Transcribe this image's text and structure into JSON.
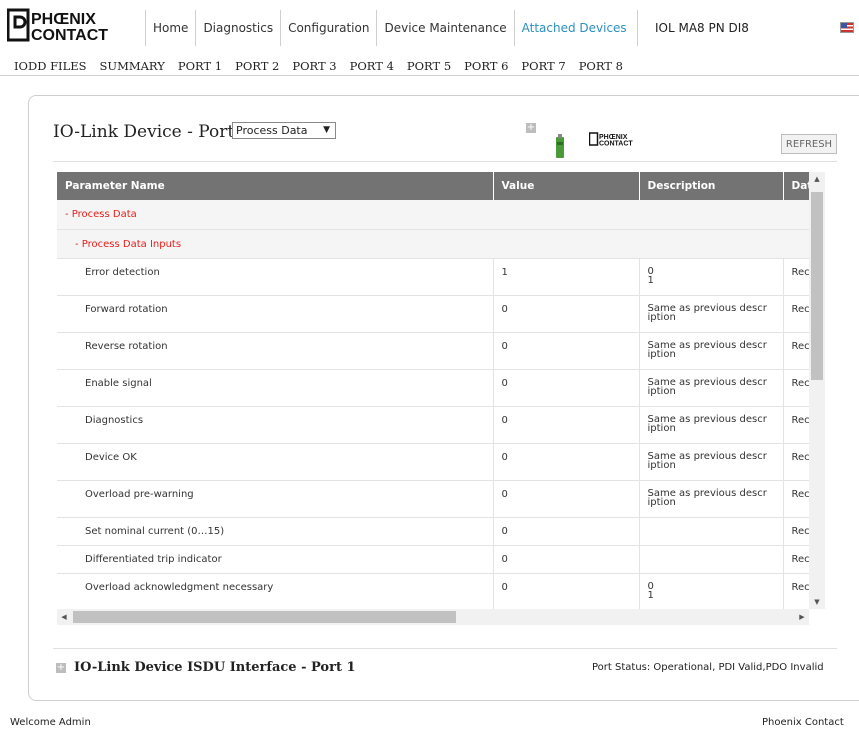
{
  "header": {
    "brand_logo": "PHOENIX CONTACT",
    "tabs": [
      {
        "label": "Home",
        "active": false
      },
      {
        "label": "Diagnostics",
        "active": false
      },
      {
        "label": "Configuration",
        "active": false
      },
      {
        "label": "Device Maintenance",
        "active": false
      },
      {
        "label": "Attached Devices",
        "active": true
      }
    ],
    "device_name": "IOL MA8 PN DI8",
    "active_color": "#2b8fbf"
  },
  "subnav": [
    "IODD FILES",
    "SUMMARY",
    "PORT 1",
    "PORT 2",
    "PORT 3",
    "PORT 4",
    "PORT 5",
    "PORT 6",
    "PORT 7",
    "PORT 8"
  ],
  "panel": {
    "title": "IO-Link Device - Port 1",
    "select_value": "Process Data",
    "brand_logo": "PHOENIX CONTACT",
    "refresh_label": "REFRESH"
  },
  "table": {
    "columns": [
      "Parameter Name",
      "Value",
      "Description",
      "DataT"
    ],
    "groups": [
      "- Process Data",
      "- Process Data Inputs"
    ],
    "rows": [
      {
        "name": "Error detection",
        "value": "1",
        "desc1": "0",
        "desc2": "1",
        "type": "Recor"
      },
      {
        "name": "Forward rotation",
        "value": "0",
        "desc1": "Same as previous descr",
        "desc2": "iption",
        "type": "Recor"
      },
      {
        "name": "Reverse rotation",
        "value": "0",
        "desc1": "Same as previous descr",
        "desc2": "iption",
        "type": "Recor"
      },
      {
        "name": "Enable signal",
        "value": "0",
        "desc1": "Same as previous descr",
        "desc2": "iption",
        "type": "Recor"
      },
      {
        "name": "Diagnostics",
        "value": "0",
        "desc1": "Same as previous descr",
        "desc2": "iption",
        "type": "Recor"
      },
      {
        "name": "Device OK",
        "value": "0",
        "desc1": "Same as previous descr",
        "desc2": "iption",
        "type": "Recor"
      },
      {
        "name": "Overload pre-warning",
        "value": "0",
        "desc1": "Same as previous descr",
        "desc2": "iption",
        "type": "Recor"
      },
      {
        "name": "Set nominal current (0…15)",
        "value": "0",
        "desc1": "",
        "desc2": "",
        "type": "Recor"
      },
      {
        "name": "Differentiated trip indicator",
        "value": "0",
        "desc1": "",
        "desc2": "",
        "type": "Recor"
      },
      {
        "name": "Overload acknowledgment necessary",
        "value": "0",
        "desc1": "0",
        "desc2": "1",
        "type": "Recor"
      }
    ],
    "group_color": "#e8201b",
    "header_bg": "#737373"
  },
  "isdu": {
    "title": "IO-Link Device ISDU Interface - Port 1",
    "port_status": "Port Status: Operational, PDI Valid,PDO Invalid"
  },
  "footer": {
    "left": "Welcome Admin",
    "right": "Phoenix Contact"
  }
}
